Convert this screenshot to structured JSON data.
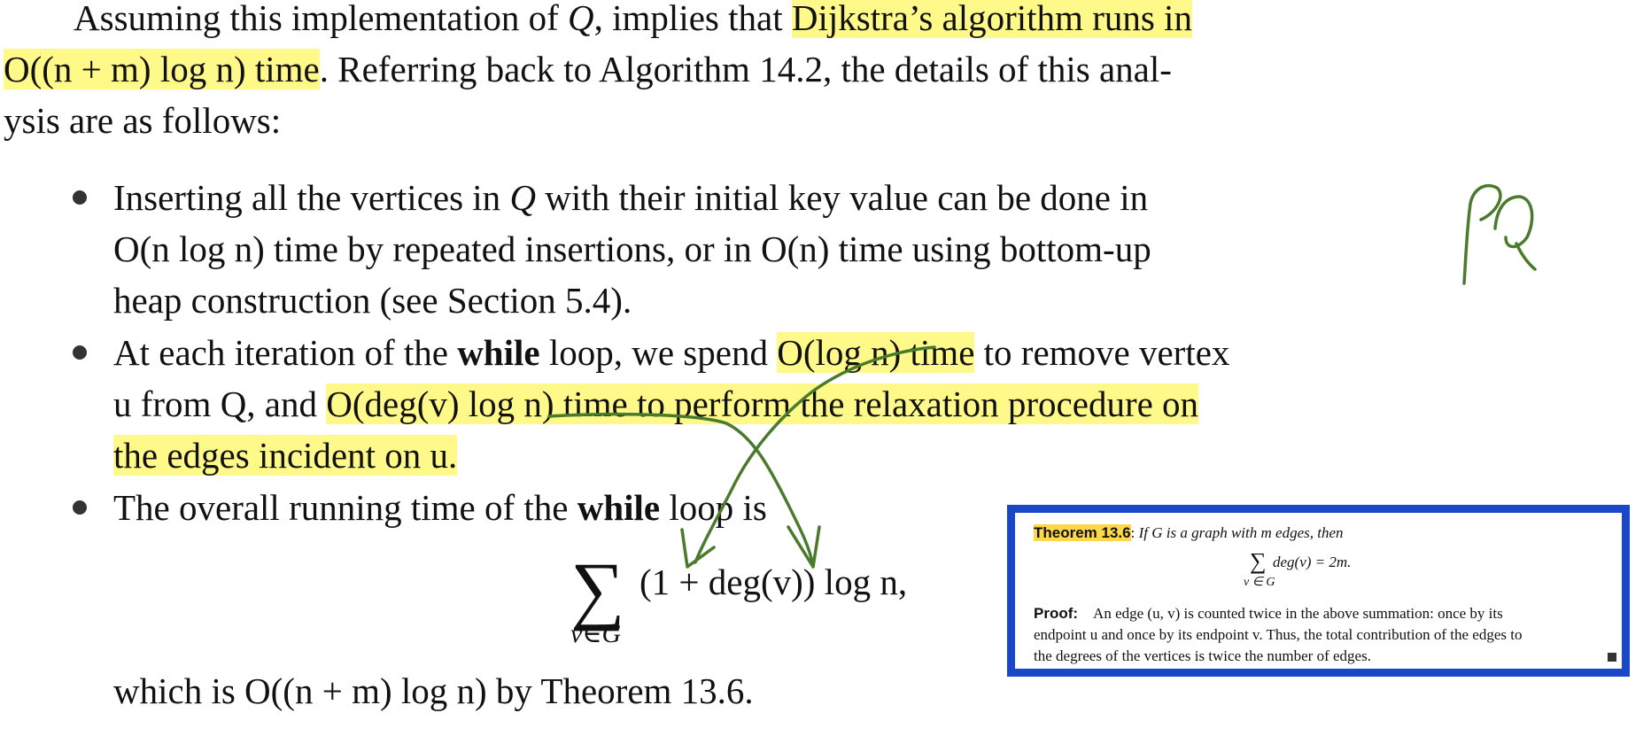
{
  "intro": {
    "l1_pre": "Assuming this implementation of ",
    "l1_Q": "Q",
    "l1_mid": ", implies that ",
    "l1_hl": "Dijkstra’s algorithm runs in",
    "l2_hl": "O((n + m) log n) time",
    "l2_rest": ". Referring back to Algorithm 14.2, the details of this anal-",
    "l3": "ysis are as follows:"
  },
  "bullet1": {
    "l1_pre": "Inserting all the vertices in ",
    "l1_Q": "Q",
    "l1_post": " with their initial key value can be done in",
    "l2": "O(n log n) time by repeated insertions, or in O(n) time using bottom-up",
    "l3": "heap construction (see Section 5.4)."
  },
  "bullet2": {
    "l1_pre": "At each iteration of the ",
    "l1_bold": "while",
    "l1_mid": " loop, we spend ",
    "l1_hl": "O(log n) time",
    "l1_post": " to remove vertex",
    "l2_pre": "u from Q, and ",
    "l2_hl": "O(deg(v) log n) time to perform the relaxation procedure on",
    "l3_hl": "the edges incident on u."
  },
  "bullet3": {
    "l1_pre": "The overall running time of the ",
    "l1_bold": "while",
    "l1_post": " loop is",
    "formula_sum": "∑",
    "formula_body": "(1 + deg(v)) log n,",
    "formula_sub": "v∈G",
    "conclusion": "which is O((n + m) log n) by Theorem 13.6."
  },
  "theorem": {
    "head": "Theorem 13.6",
    "colon": ":",
    "statement": " If G is a graph with m edges, then",
    "sum_sym": "∑",
    "sum_body": "deg(v) = 2m.",
    "sum_sub": "v ∈ G",
    "proof_head": "Proof:",
    "proof_l1": "An edge (u, v) is counted twice in the above summation: once by its",
    "proof_l2": "endpoint u and once by its endpoint v. Thus, the total contribution of the edges to",
    "proof_l3": "the degrees of the vertices is twice the number of edges."
  },
  "annotation": {
    "ink_color": "#4a7a2c",
    "margin_note": "PQ"
  },
  "colors": {
    "highlight": "#fff98a",
    "theorem_border": "#1a47c8",
    "theorem_head_bg": "#ffd84a"
  }
}
